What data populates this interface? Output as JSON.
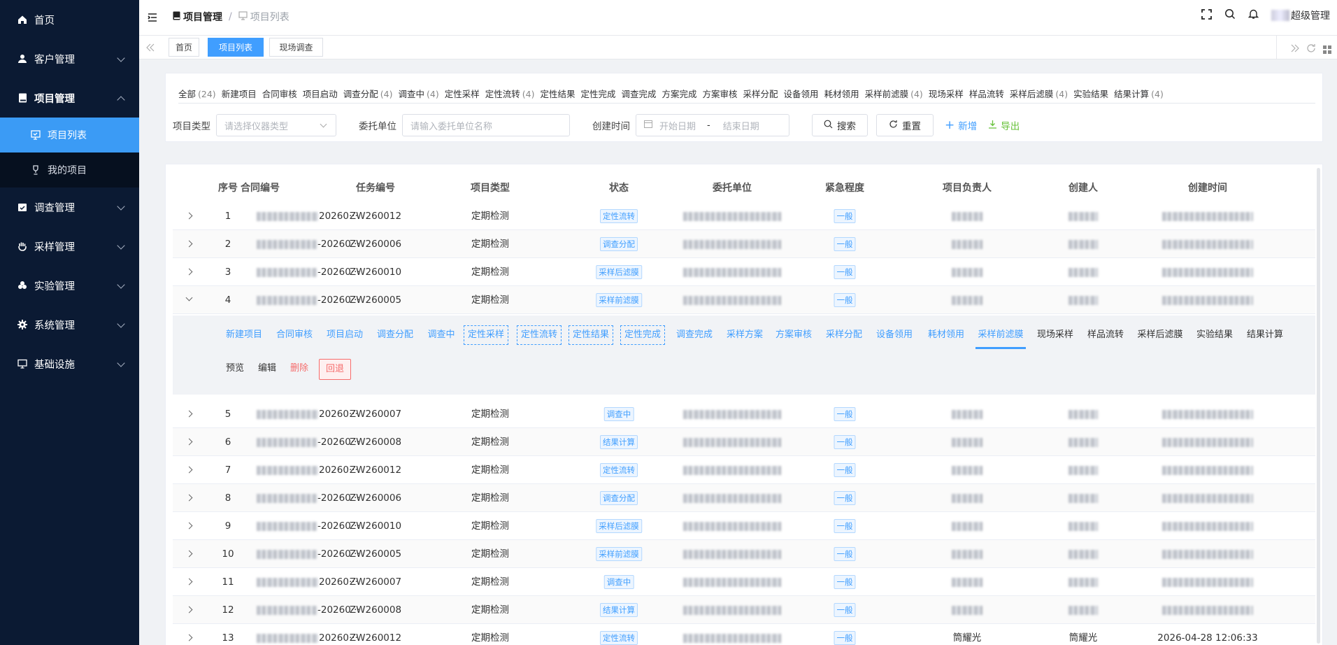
{
  "sidebar": {
    "items": [
      {
        "label": "首页",
        "icon": "home-icon"
      },
      {
        "label": "客户管理",
        "icon": "user-icon"
      },
      {
        "label": "项目管理",
        "icon": "book-icon",
        "open": true,
        "children": [
          {
            "label": "项目列表",
            "icon": "list-icon",
            "active": true
          },
          {
            "label": "我的项目",
            "icon": "trophy-icon"
          }
        ]
      },
      {
        "label": "调查管理",
        "icon": "calendar-check-icon"
      },
      {
        "label": "采样管理",
        "icon": "hand-icon"
      },
      {
        "label": "实验管理",
        "icon": "flask-icon"
      },
      {
        "label": "系统管理",
        "icon": "gear-icon"
      },
      {
        "label": "基础设施",
        "icon": "monitor-icon"
      }
    ]
  },
  "header": {
    "breadcrumb": [
      "项目管理",
      "/",
      "项目列表"
    ],
    "user": "超级管理"
  },
  "tabs": [
    {
      "label": "首页"
    },
    {
      "label": "项目列表",
      "active": true
    },
    {
      "label": "现场调查"
    }
  ],
  "status_tabs": [
    {
      "label": "全部",
      "count": "(24)"
    },
    {
      "label": "新建项目",
      "count": ""
    },
    {
      "label": "合同审核",
      "count": ""
    },
    {
      "label": "项目启动",
      "count": ""
    },
    {
      "label": "调查分配",
      "count": "(4)"
    },
    {
      "label": "调查中",
      "count": "(4)"
    },
    {
      "label": "定性采样",
      "count": ""
    },
    {
      "label": "定性流转",
      "count": "(4)"
    },
    {
      "label": "定性结果",
      "count": ""
    },
    {
      "label": "定性完成",
      "count": ""
    },
    {
      "label": "调查完成",
      "count": ""
    },
    {
      "label": "方案完成",
      "count": ""
    },
    {
      "label": "方案审核",
      "count": ""
    },
    {
      "label": "采样分配",
      "count": ""
    },
    {
      "label": "设备领用",
      "count": ""
    },
    {
      "label": "耗材领用",
      "count": ""
    },
    {
      "label": "采样前滤膜",
      "count": "(4)"
    },
    {
      "label": "现场采样",
      "count": ""
    },
    {
      "label": "样品流转",
      "count": ""
    },
    {
      "label": "采样后滤膜",
      "count": "(4)"
    },
    {
      "label": "实验结果",
      "count": ""
    },
    {
      "label": "结果计算",
      "count": "(4)"
    }
  ],
  "filters": {
    "type_label": "项目类型",
    "type_placeholder": "请选择仪器类型",
    "unit_label": "委托单位",
    "unit_placeholder": "请输入委托单位名称",
    "time_label": "创建时间",
    "start_placeholder": "开始日期",
    "dash": "-",
    "end_placeholder": "结束日期",
    "search": "搜索",
    "reset": "重置",
    "add": "新增",
    "export": "导出"
  },
  "table": {
    "headers": [
      "序号",
      "合同编号",
      "任务编号",
      "项目类型",
      "状态",
      "委托单位",
      "紧急程度",
      "项目负责人",
      "创建人",
      "创建时间"
    ],
    "rows": [
      {
        "no": "1",
        "contract": "20260···",
        "task": "ZW260012",
        "type": "定期检测",
        "status": "定性流转",
        "urgency": "一般"
      },
      {
        "no": "2",
        "contract": "-20260···",
        "task": "ZW260006",
        "type": "定期检测",
        "status": "调查分配",
        "urgency": "一般"
      },
      {
        "no": "3",
        "contract": "-20260···",
        "task": "ZW260010",
        "type": "定期检测",
        "status": "采样后滤膜",
        "urgency": "一般"
      },
      {
        "no": "4",
        "contract": "-20260···",
        "task": "ZW260005",
        "type": "定期检测",
        "status": "采样前滤膜",
        "urgency": "一般",
        "expanded": true
      },
      {
        "no": "5",
        "contract": "20260···",
        "task": "ZW260007",
        "type": "定期检测",
        "status": "调查中",
        "urgency": "一般"
      },
      {
        "no": "6",
        "contract": "-20260···",
        "task": "ZW260008",
        "type": "定期检测",
        "status": "结果计算",
        "urgency": "一般"
      },
      {
        "no": "7",
        "contract": "20260···",
        "task": "ZW260012",
        "type": "定期检测",
        "status": "定性流转",
        "urgency": "一般"
      },
      {
        "no": "8",
        "contract": "-20260···",
        "task": "ZW260006",
        "type": "定期检测",
        "status": "调查分配",
        "urgency": "一般"
      },
      {
        "no": "9",
        "contract": "-20260···",
        "task": "ZW260010",
        "type": "定期检测",
        "status": "采样后滤膜",
        "urgency": "一般"
      },
      {
        "no": "10",
        "contract": "-20260···",
        "task": "ZW260005",
        "type": "定期检测",
        "status": "采样前滤膜",
        "urgency": "一般"
      },
      {
        "no": "11",
        "contract": "20260···",
        "task": "ZW260007",
        "type": "定期检测",
        "status": "调查中",
        "urgency": "一般"
      },
      {
        "no": "12",
        "contract": "-20260···",
        "task": "ZW260008",
        "type": "定期检测",
        "status": "结果计算",
        "urgency": "一般"
      },
      {
        "no": "13",
        "contract": "20260···",
        "task": "ZW260012",
        "type": "定期检测",
        "status": "定性流转",
        "urgency": "一般",
        "manager": "筒耀光",
        "creator": "筒耀光",
        "created": "2026-04-28 12:06:33"
      }
    ]
  },
  "expanded": {
    "steps": [
      "新建项目",
      "合同审核",
      "项目启动",
      "调查分配",
      "调查中",
      "定性采样",
      "定性流转",
      "定性结果",
      "定性完成",
      "调查完成",
      "采样方案",
      "方案审核",
      "采样分配",
      "设备领用",
      "耗材领用",
      "采样前滤膜",
      "现场采样",
      "样品流转",
      "采样后滤膜",
      "实验结果",
      "结果计算"
    ],
    "actions": {
      "preview": "预览",
      "edit": "编辑",
      "delete": "删除",
      "rollback": "回退"
    }
  },
  "colors": {
    "primary": "#409eff",
    "sidebar": "#0b1a33",
    "active": "#3b9bf5",
    "danger": "#f56c6c",
    "success": "#67c23a"
  }
}
